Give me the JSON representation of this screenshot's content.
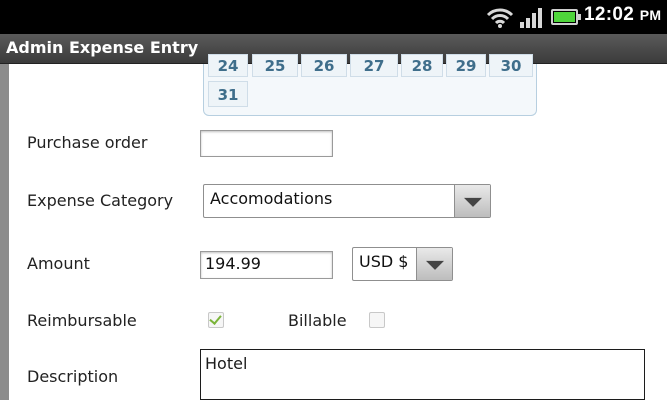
{
  "status_bar": {
    "time": "12:02",
    "time_suffix": "PM"
  },
  "title_bar": {
    "title": "Admin Expense Entry"
  },
  "calendar": {
    "partial_row": [
      "24",
      "25",
      "26",
      "27",
      "28",
      "29",
      "30"
    ],
    "last_row": [
      "31"
    ]
  },
  "form": {
    "purchase_order": {
      "label": "Purchase order",
      "value": ""
    },
    "expense_category": {
      "label": "Expense Category",
      "value": "Accomodations"
    },
    "amount": {
      "label": "Amount",
      "value": "194.99",
      "currency": "USD $"
    },
    "reimbursable": {
      "label": "Reimbursable",
      "checked": true
    },
    "billable": {
      "label": "Billable",
      "checked": false
    },
    "description": {
      "label": "Description",
      "value": "Hotel"
    }
  },
  "colors": {
    "accent_check": "#7bb43a",
    "calendar_text": "#3f6e8b",
    "battery": "#4fd53b"
  }
}
